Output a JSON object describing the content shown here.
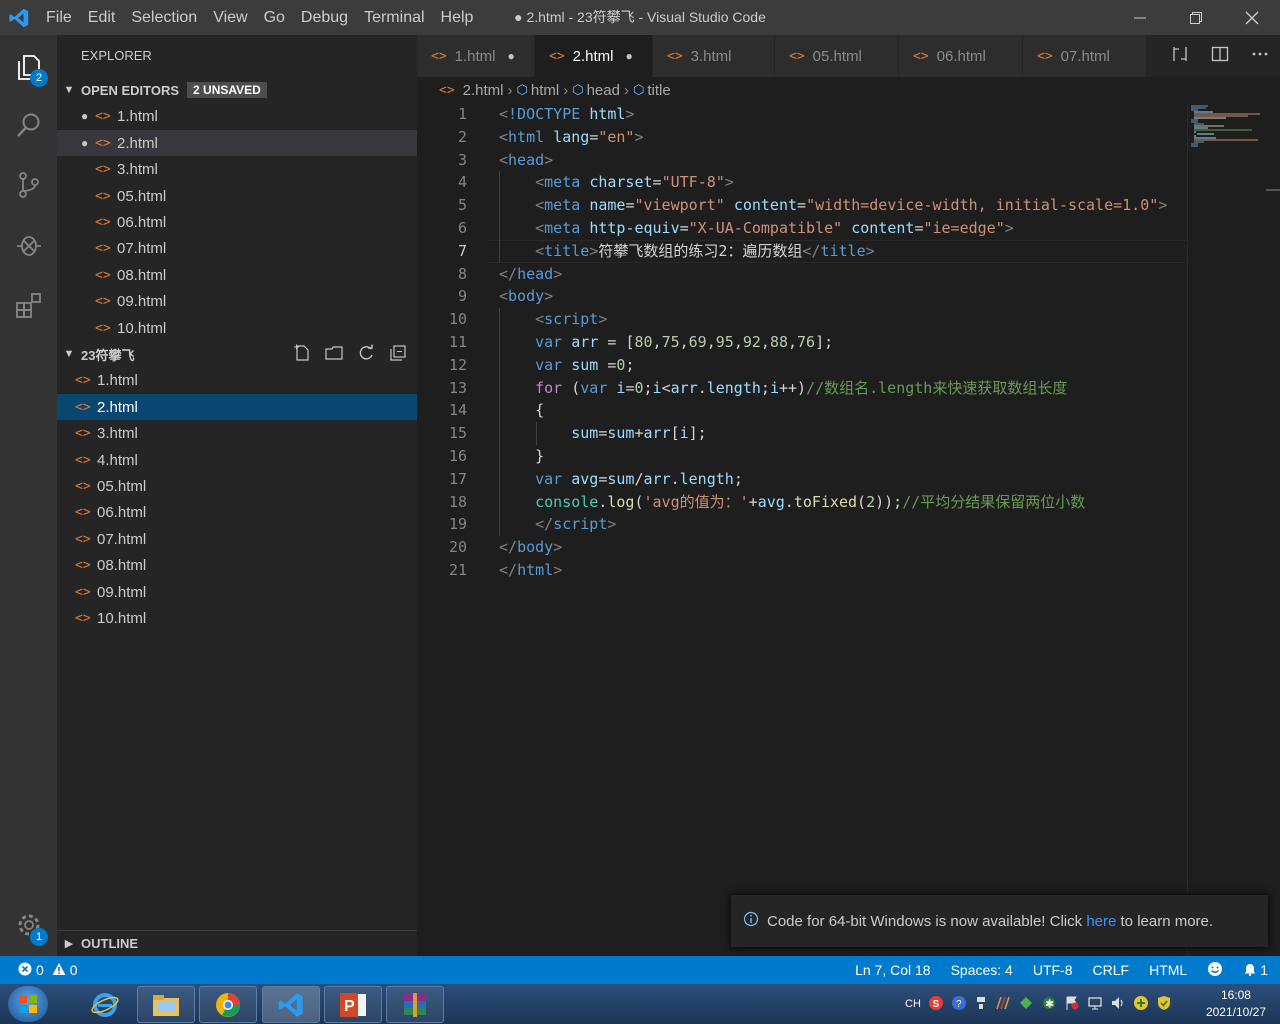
{
  "menu": [
    "File",
    "Edit",
    "Selection",
    "View",
    "Go",
    "Debug",
    "Terminal",
    "Help"
  ],
  "window_title": "● 2.html - 23符攀飞 - Visual Studio Code",
  "activity": {
    "explorer_badge": "2",
    "settings_badge": "1"
  },
  "explorer": {
    "title": "EXPLORER",
    "open_editors_label": "OPEN EDITORS",
    "unsaved_label": "2 UNSAVED",
    "open_editors": [
      "1.html",
      "2.html",
      "3.html",
      "05.html",
      "06.html",
      "07.html",
      "08.html",
      "09.html",
      "10.html"
    ],
    "folder_label": "23符攀飞",
    "folder_files": [
      "1.html",
      "2.html",
      "3.html",
      "4.html",
      "05.html",
      "06.html",
      "07.html",
      "08.html",
      "09.html",
      "10.html"
    ],
    "outline_label": "OUTLINE"
  },
  "tabs": [
    "1.html",
    "2.html",
    "3.html",
    "05.html",
    "06.html",
    "07.html"
  ],
  "breadcrumb": [
    "2.html",
    "html",
    "head",
    "title"
  ],
  "code": {
    "line_numbers": [
      "1",
      "2",
      "3",
      "4",
      "5",
      "6",
      "7",
      "8",
      "9",
      "10",
      "11",
      "12",
      "13",
      "14",
      "15",
      "16",
      "17",
      "18",
      "19",
      "20",
      "21"
    ]
  },
  "notification": {
    "before": "Code for 64-bit Windows is now available! Click ",
    "link": "here",
    "after": " to learn more."
  },
  "status": {
    "errors": "0",
    "warnings": "0",
    "position": "Ln 7, Col 18",
    "spaces": "Spaces: 4",
    "encoding": "UTF-8",
    "eol": "CRLF",
    "language": "HTML",
    "bell_count": "1"
  },
  "taskbar": {
    "ime": "CH",
    "time": "16:08",
    "date": "2021/10/27"
  }
}
